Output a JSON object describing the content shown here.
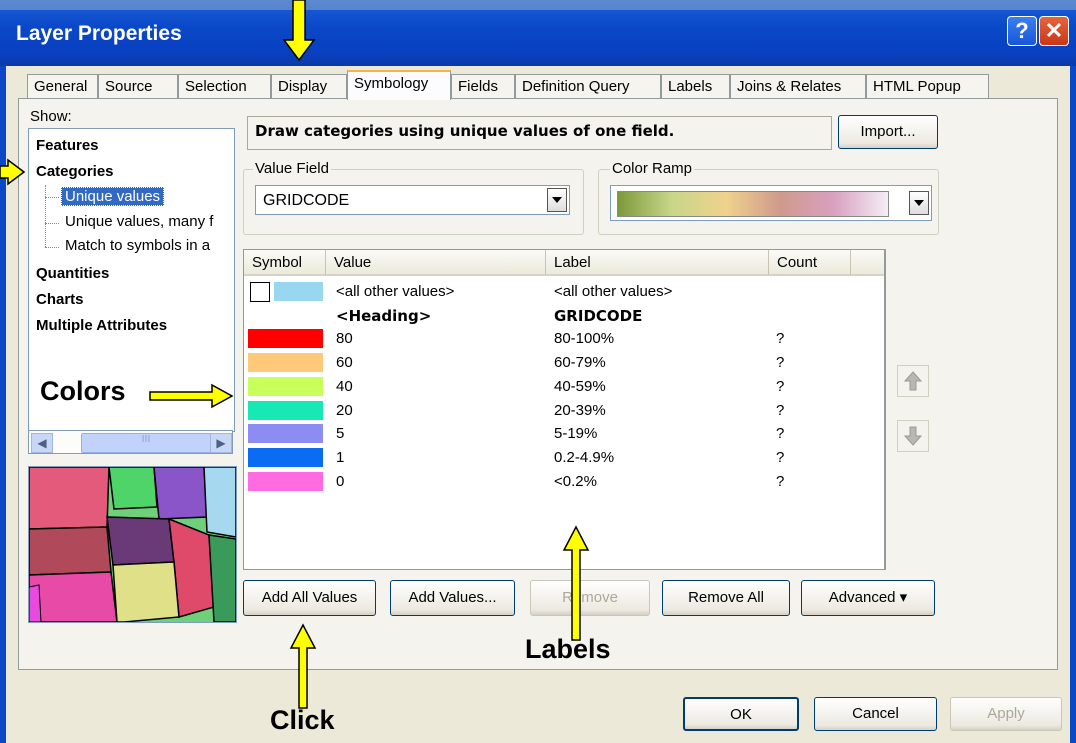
{
  "window": {
    "title": "Layer Properties",
    "help_glyph": "?",
    "close_glyph": "✕"
  },
  "tabs": [
    {
      "label": "General"
    },
    {
      "label": "Source"
    },
    {
      "label": "Selection"
    },
    {
      "label": "Display"
    },
    {
      "label": "Symbology",
      "active": true
    },
    {
      "label": "Fields"
    },
    {
      "label": "Definition Query"
    },
    {
      "label": "Labels"
    },
    {
      "label": "Joins & Relates"
    },
    {
      "label": "HTML Popup"
    }
  ],
  "show": {
    "label": "Show:",
    "items": [
      {
        "label": "Features",
        "bold": true
      },
      {
        "label": "Categories",
        "bold": true
      },
      {
        "label": "Unique values",
        "selected": true
      },
      {
        "label": "Unique values, many f"
      },
      {
        "label": "Match to symbols in a"
      },
      {
        "label": "Quantities",
        "bold": true
      },
      {
        "label": "Charts",
        "bold": true
      },
      {
        "label": "Multiple Attributes",
        "bold": true
      }
    ],
    "scroll_grip": "III"
  },
  "description": "Draw categories using unique values of one field.",
  "import_label": "Import...",
  "value_field": {
    "label": "Value Field",
    "value": "GRIDCODE"
  },
  "color_ramp": {
    "label": "Color Ramp",
    "colors": [
      "#7d9a3c",
      "#c8d68a",
      "#f0d28c",
      "#cf9a8c",
      "#d9a0c0",
      "#f4eef6"
    ]
  },
  "table": {
    "headers": [
      "Symbol",
      "Value",
      "Label",
      "Count"
    ],
    "rows": [
      {
        "color": "#99d6f0",
        "value": "<all other values>",
        "label": "<all other values>",
        "count": "",
        "other": true
      },
      {
        "color": "",
        "value": "<Heading>",
        "label": "GRIDCODE",
        "count": "",
        "heading": true
      },
      {
        "color": "#ff0000",
        "value": "80",
        "label": "80-100%",
        "count": "?"
      },
      {
        "color": "#ffc97a",
        "value": "60",
        "label": "60-79%",
        "count": "?"
      },
      {
        "color": "#c8ff5a",
        "value": "40",
        "label": "40-59%",
        "count": "?"
      },
      {
        "color": "#17e8b4",
        "value": "20",
        "label": "20-39%",
        "count": "?"
      },
      {
        "color": "#8c8cf2",
        "value": "5",
        "label": "5-19%",
        "count": "?"
      },
      {
        "color": "#0a6cf2",
        "value": "1",
        "label": "0.2-4.9%",
        "count": "?"
      },
      {
        "color": "#ff6be0",
        "value": "0",
        "label": "<0.2%",
        "count": "?"
      }
    ]
  },
  "buttons": {
    "add_all_values": "Add All Values",
    "add_values": "Add Values...",
    "remove": "Remove",
    "remove_all": "Remove All",
    "advanced": "Advanced ▾",
    "ok": "OK",
    "cancel": "Cancel",
    "apply": "Apply"
  },
  "annotations": {
    "colors": "Colors",
    "labels": "Labels",
    "click": "Click",
    "arrow_color": "#ffff00"
  }
}
